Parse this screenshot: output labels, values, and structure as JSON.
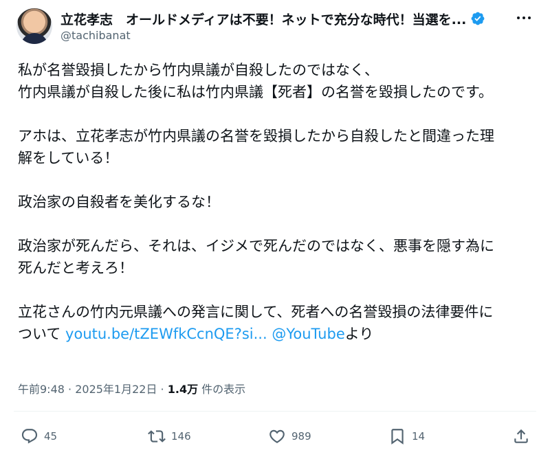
{
  "user": {
    "display_name": "立花孝志　オールドメディアは不要！ネットで充分な時代！当選を...",
    "handle": "@tachibanat"
  },
  "tweet": {
    "paragraphs": [
      [
        "私が名誉毀損したから竹内県議が自殺したのではなく、",
        "竹内県議が自殺した後に私は竹内県議【死者】の名誉を毀損したのです。"
      ],
      [
        "アホは、立花孝志が竹内県議の名誉を毀損したから自殺したと間違った理",
        "解をしている！"
      ],
      [
        "政治家の自殺者を美化するな！"
      ],
      [
        "政治家が死んだら、それは、イジメで死んだのではなく、悪事を隠す為に",
        "死んだと考えろ！"
      ]
    ],
    "last_paragraph": {
      "line1": "立花さんの竹内元県議への発言に関して、死者への名誉毀損の法律要件に",
      "line2_prefix": "ついて ",
      "link_text": "youtu.be/tZEWfkCcnQE?si...",
      "mention": "@YouTube",
      "suffix": "より"
    }
  },
  "meta": {
    "time": "午前9:48",
    "separator": " · ",
    "date": "2025年1月22日",
    "views_count": "1.4万",
    "views_label": " 件の表示"
  },
  "actions": {
    "replies": "45",
    "reposts": "146",
    "likes": "989",
    "bookmarks": "14"
  },
  "colors": {
    "text": "#0f1419",
    "secondary": "#536471",
    "link": "#1d9bf0",
    "verified": "#1d9bf0"
  },
  "icons": [
    "verified-badge-icon",
    "more-icon",
    "reply-icon",
    "repost-icon",
    "like-icon",
    "bookmark-icon",
    "share-icon"
  ]
}
